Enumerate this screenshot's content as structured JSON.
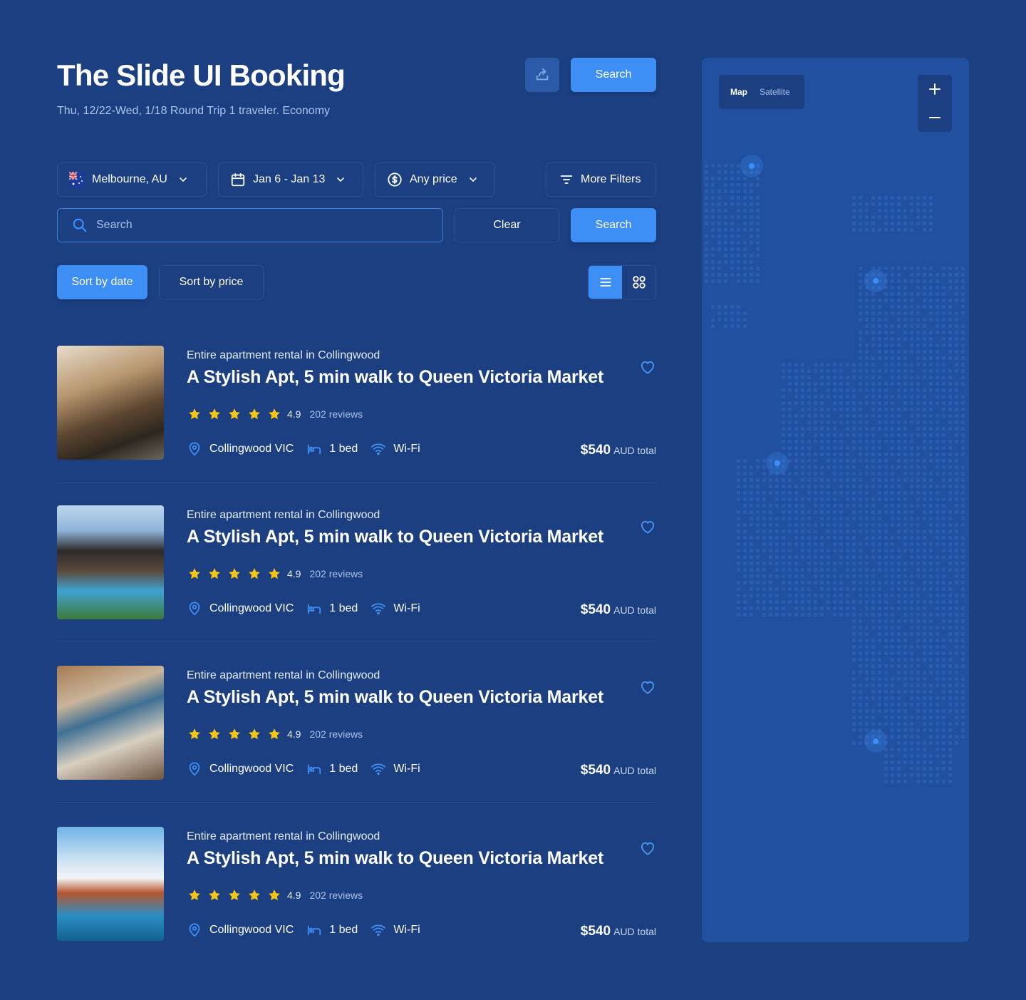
{
  "header": {
    "title": "The Slide UI Booking",
    "subtitle": "Thu, 12/22-Wed, 1/18 Round Trip 1 traveler. Economy",
    "search_label": "Search"
  },
  "filters": {
    "location": "Melbourne, AU",
    "dates": "Jan 6 - Jan 13",
    "price": "Any price",
    "more": "More Filters"
  },
  "search": {
    "placeholder": "Search",
    "clear_label": "Clear",
    "submit_label": "Search"
  },
  "sort": {
    "by_date": "Sort by date",
    "by_price": "Sort by price"
  },
  "listings": [
    {
      "type": "Entire apartment rental in Collingwood",
      "title": "A Stylish Apt, 5 min walk to Queen Victoria Market",
      "rating": "4.9",
      "reviews": "202 reviews",
      "location": "Collingwood VIC",
      "beds": "1 bed",
      "amenity": "Wi-Fi",
      "price": "$540",
      "price_unit": "AUD total"
    },
    {
      "type": "Entire apartment rental in Collingwood",
      "title": "A Stylish Apt, 5 min walk to Queen Victoria Market",
      "rating": "4.9",
      "reviews": "202 reviews",
      "location": "Collingwood VIC",
      "beds": "1 bed",
      "amenity": "Wi-Fi",
      "price": "$540",
      "price_unit": "AUD total"
    },
    {
      "type": "Entire apartment rental in Collingwood",
      "title": "A Stylish Apt, 5 min walk to Queen Victoria Market",
      "rating": "4.9",
      "reviews": "202 reviews",
      "location": "Collingwood VIC",
      "beds": "1 bed",
      "amenity": "Wi-Fi",
      "price": "$540",
      "price_unit": "AUD total"
    },
    {
      "type": "Entire apartment rental in Collingwood",
      "title": "A Stylish Apt, 5 min walk to Queen Victoria Market",
      "rating": "4.9",
      "reviews": "202 reviews",
      "location": "Collingwood VIC",
      "beds": "1 bed",
      "amenity": "Wi-Fi",
      "price": "$540",
      "price_unit": "AUD total"
    }
  ],
  "map": {
    "map_label": "Map",
    "satellite_label": "Satellite",
    "zoom_in": "+",
    "zoom_out": "−"
  },
  "colors": {
    "background": "#1b3f80",
    "accent": "#3d8ef5",
    "star": "#f5c518",
    "map_bg": "#2150a0"
  }
}
